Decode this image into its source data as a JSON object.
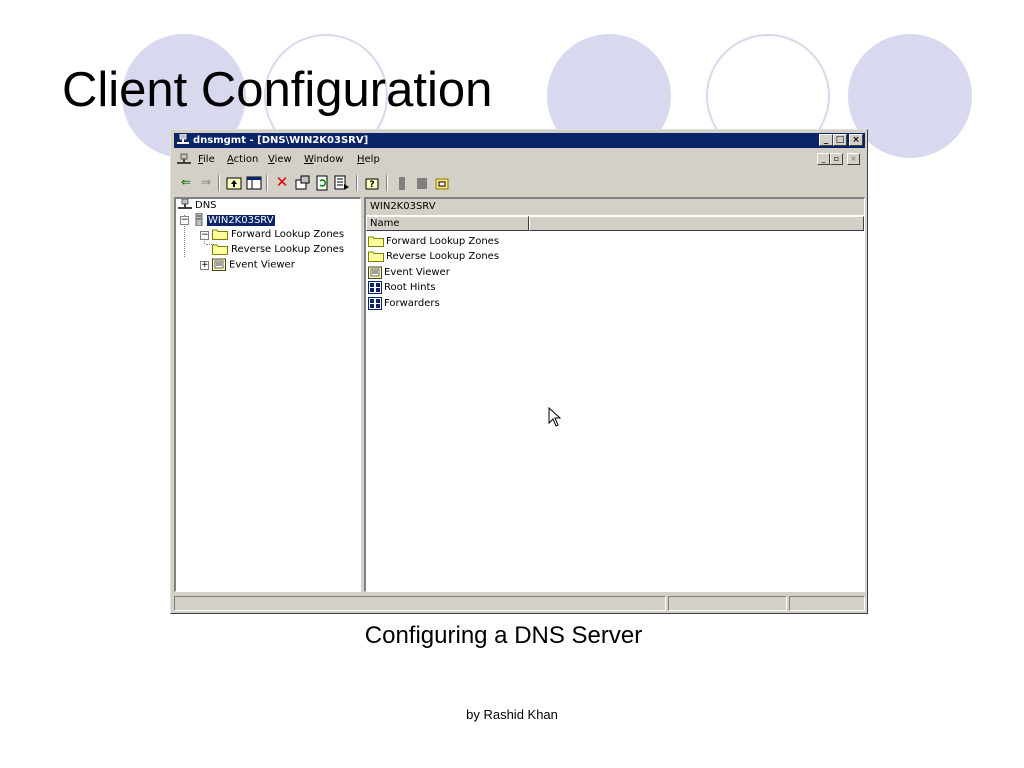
{
  "slide": {
    "title": "Client Configuration",
    "caption": "Configuring a DNS Server",
    "byline": "by  Rashid Khan",
    "accent_color": "#d8d8ee"
  },
  "window": {
    "title": "dnsmgmt - [DNS\\WIN2K03SRV]",
    "title_bar_color": "#0a246a",
    "caption_buttons": {
      "minimize": "_",
      "maximize": "□",
      "close": "×"
    },
    "menu": {
      "file": {
        "mnemonic": "F",
        "rest": "ile"
      },
      "action": {
        "mnemonic": "A",
        "rest": "ction"
      },
      "view": {
        "mnemonic": "V",
        "rest": "iew"
      },
      "window": {
        "mnemonic": "W",
        "rest": "indow"
      },
      "help": {
        "mnemonic": "H",
        "rest": "elp"
      }
    },
    "mdi_buttons": {
      "minimize": "_",
      "restore": "▫",
      "close": "×"
    },
    "toolbar": [
      "back-icon",
      "forward-icon",
      "up-one-level-icon",
      "show-hide-tree-icon",
      "delete-icon",
      "properties-icon",
      "refresh-icon",
      "export-list-icon",
      "help-icon",
      "server-icon",
      "zone-icon",
      "new-record-icon"
    ],
    "tree": {
      "root": "DNS",
      "server": "WIN2K03SRV",
      "forward": "Forward Lookup Zones",
      "reverse": "Reverse Lookup Zones",
      "events": "Event Viewer",
      "collapse_glyph": "−",
      "expand_glyph": "+"
    },
    "right_pane": {
      "header": "WIN2K03SRV",
      "column_name": "Name",
      "items": [
        {
          "label": "Forward Lookup Zones",
          "icon": "folder-icon"
        },
        {
          "label": "Reverse Lookup Zones",
          "icon": "folder-icon"
        },
        {
          "label": "Event Viewer",
          "icon": "event-viewer-icon"
        },
        {
          "label": "Root Hints",
          "icon": "root-hints-icon"
        },
        {
          "label": "Forwarders",
          "icon": "forwarders-icon"
        }
      ]
    }
  }
}
